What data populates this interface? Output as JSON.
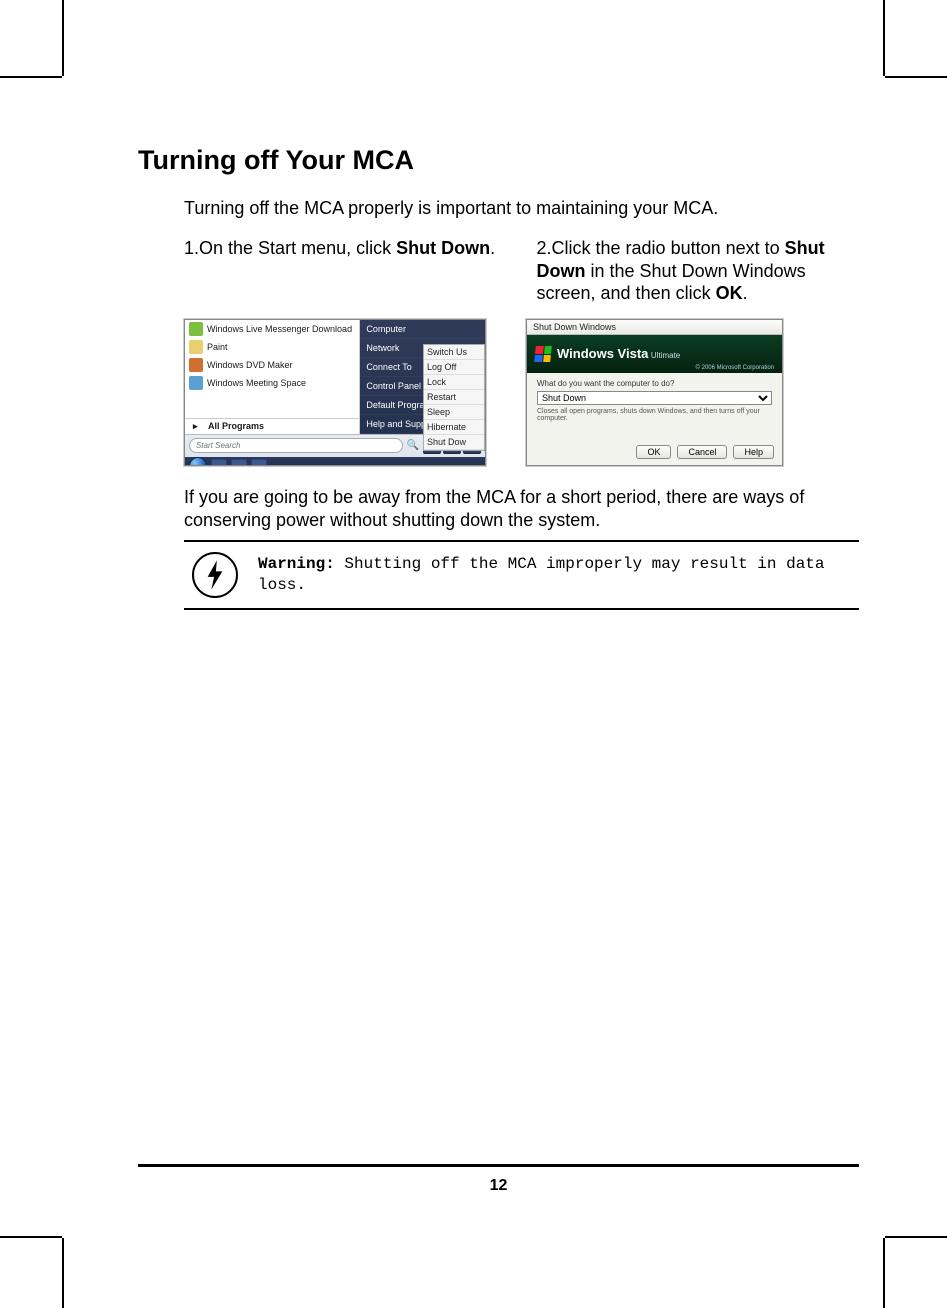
{
  "title": "Turning off Your MCA",
  "intro": "Turning off the MCA properly is important to maintaining your MCA.",
  "steps": [
    {
      "num": "1.",
      "before": "On the Start menu, click ",
      "bold": "Shut Down",
      "after": "."
    },
    {
      "num": "2.",
      "before": "Click the radio button next to ",
      "bold": "Shut Down",
      "mid": " in the Shut Down Windows screen, and then click ",
      "bold2": "OK",
      "after": "."
    }
  ],
  "startmenu": {
    "left_items": [
      {
        "label": "Windows Live Messenger Download",
        "icon": "#7fbf3f"
      },
      {
        "label": "Paint",
        "icon": "#e8d070"
      },
      {
        "label": "Windows DVD Maker",
        "icon": "#d07030"
      },
      {
        "label": "Windows Meeting Space",
        "icon": "#5aa0d0"
      }
    ],
    "all_programs": "All Programs",
    "right_items": [
      "Computer",
      "Network",
      "Connect To",
      "Control Panel",
      "Default Programs",
      "Help and Support"
    ],
    "flyout": [
      "Switch Us",
      "Log Off",
      "Lock",
      "Restart",
      "Sleep",
      "Hibernate",
      "Shut Dow"
    ],
    "search_placeholder": "Start Search"
  },
  "shutdown_dialog": {
    "title": "Shut Down Windows",
    "brand": "Windows Vista",
    "edition": "Ultimate",
    "copyright": "© 2006 Microsoft Corporation",
    "question": "What do you want the computer to do?",
    "selected": "Shut Down",
    "description": "Closes all open programs, shuts down Windows, and then turns off your computer.",
    "buttons": [
      "OK",
      "Cancel",
      "Help"
    ]
  },
  "after": "If you are going to be away from the MCA for a short period, there are ways of conserving power without shutting down the system.",
  "warning": {
    "label": "Warning:",
    "text": " Shutting off the MCA improperly may result in data loss."
  },
  "page_number": "12"
}
